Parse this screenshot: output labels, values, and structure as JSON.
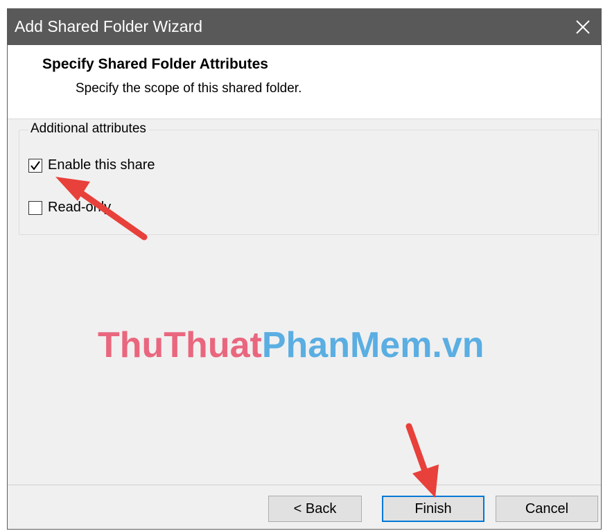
{
  "window": {
    "title": "Add Shared Folder Wizard",
    "close_icon": "close-icon"
  },
  "header": {
    "title": "Specify Shared Folder Attributes",
    "subtitle": "Specify the scope of this shared folder."
  },
  "attributes": {
    "legend": "Additional attributes",
    "options": [
      {
        "label": "Enable this share",
        "checked": true
      },
      {
        "label": "Read-only",
        "checked": false
      }
    ]
  },
  "watermark": {
    "part1": "ThuThuat",
    "part2": "PhanMem.vn",
    "color1": "#e9677e",
    "color2": "#5aaee2"
  },
  "buttons": {
    "back": "< Back",
    "finish": "Finish",
    "cancel": "Cancel"
  },
  "colors": {
    "titlebar": "#595959",
    "dialog_bg": "#f0f0f0",
    "accent": "#0078d7",
    "arrow": "#e8403a"
  }
}
